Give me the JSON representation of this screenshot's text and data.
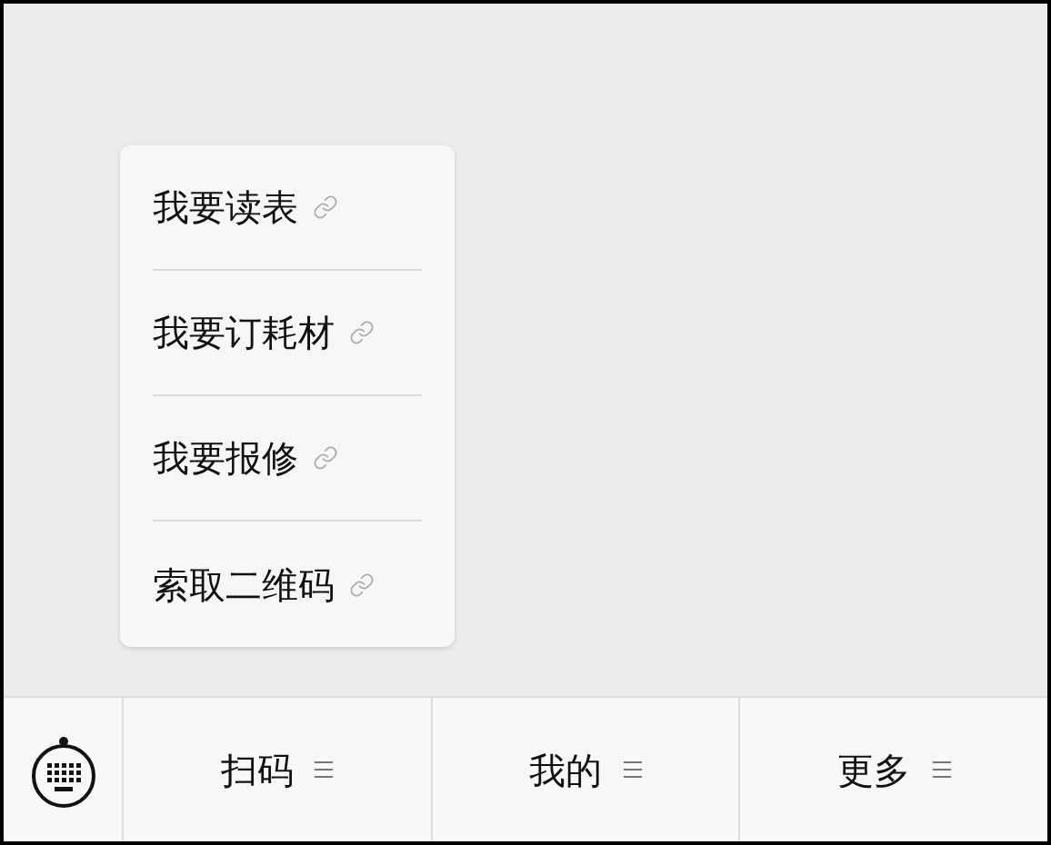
{
  "menu_popup": {
    "items": [
      {
        "label": "我要读表"
      },
      {
        "label": "我要订耗材"
      },
      {
        "label": "我要报修"
      },
      {
        "label": "索取二维码"
      }
    ]
  },
  "bottom_bar": {
    "tabs": [
      {
        "label": "扫码"
      },
      {
        "label": "我的"
      },
      {
        "label": "更多"
      }
    ]
  }
}
